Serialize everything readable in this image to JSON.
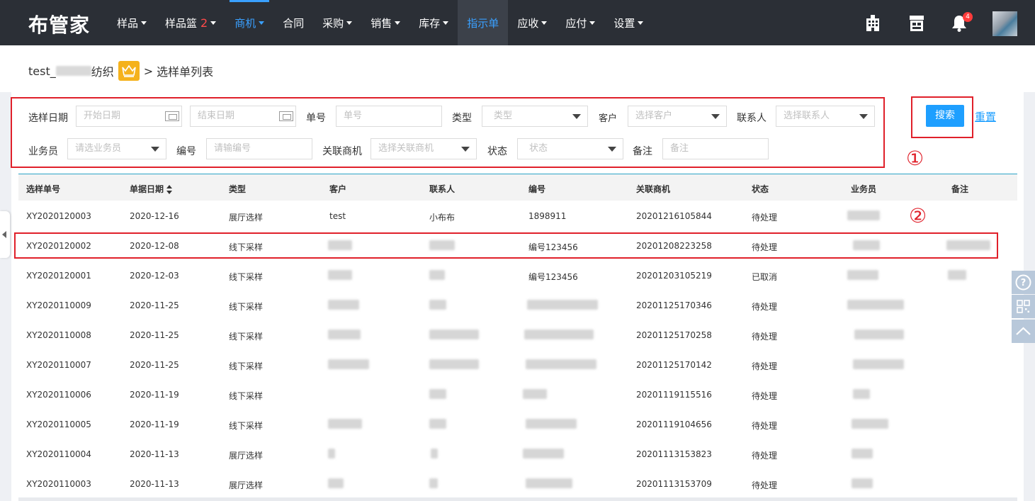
{
  "brand": {
    "logo": "布管家"
  },
  "nav": {
    "items": [
      {
        "label": "样品",
        "dropdown": true
      },
      {
        "label": "样品篮",
        "badge": "2",
        "dropdown": true
      },
      {
        "label": "商机",
        "dropdown": true,
        "state": "active"
      },
      {
        "label": "合同",
        "dropdown": false
      },
      {
        "label": "采购",
        "dropdown": true
      },
      {
        "label": "销售",
        "dropdown": true
      },
      {
        "label": "库存",
        "dropdown": true
      },
      {
        "label": "指示单",
        "dropdown": false,
        "state": "current"
      },
      {
        "label": "应收",
        "dropdown": true
      },
      {
        "label": "应付",
        "dropdown": true
      },
      {
        "label": "设置",
        "dropdown": true
      }
    ],
    "notification_count": "4",
    "icons": [
      "building-icon",
      "store-icon",
      "bell-icon",
      "avatar"
    ]
  },
  "breadcrumb": {
    "company_prefix": "test_",
    "company_suffix": "纺织",
    "separator": ">",
    "page": "选样单列表"
  },
  "filters": {
    "date_label": "选样日期",
    "start_date_placeholder": "开始日期",
    "end_date_placeholder": "结束日期",
    "order_no_label": "单号",
    "order_no_placeholder": "单号",
    "type_label": "类型",
    "type_placeholder": "类型",
    "customer_label": "客户",
    "customer_placeholder": "选择客户",
    "contact_label": "联系人",
    "contact_placeholder": "选择联系人",
    "salesman_label": "业务员",
    "salesman_placeholder": "请选业务员",
    "code_label": "编号",
    "code_placeholder": "请输编号",
    "opportunity_label": "关联商机",
    "opportunity_placeholder": "选择关联商机",
    "status_label": "状态",
    "status_placeholder": "状态",
    "remark_label": "备注",
    "remark_placeholder": "备注"
  },
  "actions": {
    "search": "搜索",
    "reset": "重置"
  },
  "annotations": {
    "marker1": "①",
    "marker2": "②",
    "color": "#e0202a"
  },
  "table": {
    "columns": [
      "选样单号",
      "单据日期",
      "类型",
      "客户",
      "联系人",
      "编号",
      "关联商机",
      "状态",
      "业务员",
      "备注"
    ],
    "rows": [
      {
        "no": "XY2020120003",
        "date": "2020-12-16",
        "type": "展厅选样",
        "customer": "test",
        "contact": "小布布",
        "code": "1898911",
        "opportunity": "20201216105844",
        "status": "待处理"
      },
      {
        "no": "XY2020120002",
        "date": "2020-12-08",
        "type": "线下采样",
        "customer": "",
        "contact": "",
        "code": "编号123456",
        "opportunity": "20201208223258",
        "status": "待处理"
      },
      {
        "no": "XY2020120001",
        "date": "2020-12-03",
        "type": "线下采样",
        "customer": "",
        "contact": "",
        "code": "编号123456",
        "opportunity": "20201203105219",
        "status": "已取消"
      },
      {
        "no": "XY2020110009",
        "date": "2020-11-25",
        "type": "线下采样",
        "customer": "",
        "contact": "",
        "code": "",
        "opportunity": "20201125170346",
        "status": "待处理"
      },
      {
        "no": "XY2020110008",
        "date": "2020-11-25",
        "type": "线下采样",
        "customer": "",
        "contact": "",
        "code": "",
        "opportunity": "20201125170258",
        "status": "待处理"
      },
      {
        "no": "XY2020110007",
        "date": "2020-11-25",
        "type": "线下采样",
        "customer": "",
        "contact": "",
        "code": "",
        "opportunity": "20201125170142",
        "status": "待处理"
      },
      {
        "no": "XY2020110006",
        "date": "2020-11-19",
        "type": "线下采样",
        "customer": "",
        "contact": "",
        "code": "",
        "opportunity": "20201119115516",
        "status": "待处理"
      },
      {
        "no": "XY2020110005",
        "date": "2020-11-19",
        "type": "线下采样",
        "customer": "",
        "contact": "",
        "code": "",
        "opportunity": "20201119104656",
        "status": "待处理"
      },
      {
        "no": "XY2020110004",
        "date": "2020-11-13",
        "type": "展厅选样",
        "customer": "",
        "contact": "",
        "code": "",
        "opportunity": "20201113153823",
        "status": "待处理"
      },
      {
        "no": "XY2020110003",
        "date": "2020-11-13",
        "type": "展厅选样",
        "customer": "",
        "contact": "",
        "code": "",
        "opportunity": "20201113153709",
        "status": "待处理"
      }
    ]
  },
  "floating": {
    "icons": [
      "help-icon",
      "qrcode-icon",
      "back-to-top-icon"
    ]
  },
  "colors": {
    "topbar": "#2b2f36",
    "accent": "#3aa0ff",
    "button": "#1e9fff",
    "badge": "#ff3b3b"
  }
}
